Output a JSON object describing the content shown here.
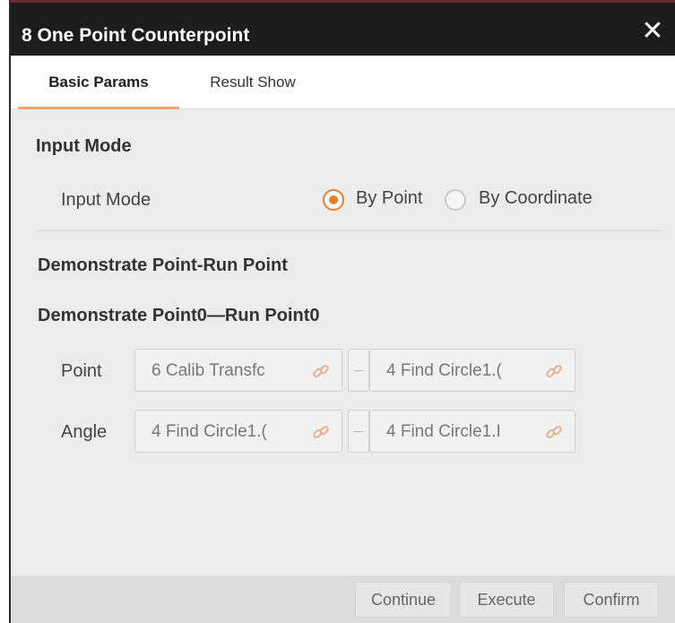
{
  "window": {
    "title": "8 One Point Counterpoint"
  },
  "tabs": [
    {
      "label": "Basic Params",
      "active": true
    },
    {
      "label": "Result Show",
      "active": false
    }
  ],
  "input_mode": {
    "heading": "Input Mode",
    "label": "Input Mode",
    "options": [
      {
        "label": "By Point",
        "selected": true
      },
      {
        "label": "By Coordinate",
        "selected": false
      }
    ]
  },
  "demonstrate": {
    "heading": "Demonstrate Point-Run Point",
    "pair_heading": "Demonstrate Point0—Run Point0",
    "rows": [
      {
        "label": "Point",
        "left": "6 Calib Transfc",
        "right": "4 Find Circle1.("
      },
      {
        "label": "Angle",
        "left": "4 Find Circle1.(",
        "right": "4 Find Circle1.I"
      }
    ]
  },
  "footer": {
    "continue": "Continue",
    "execute": "Execute",
    "confirm": "Confirm"
  },
  "colors": {
    "accent": "#f07c2e",
    "titlebar": "#1c1c1c",
    "tab_underline": "#f0a46a"
  },
  "icons": {
    "close": "close-icon",
    "link": "link-icon"
  }
}
